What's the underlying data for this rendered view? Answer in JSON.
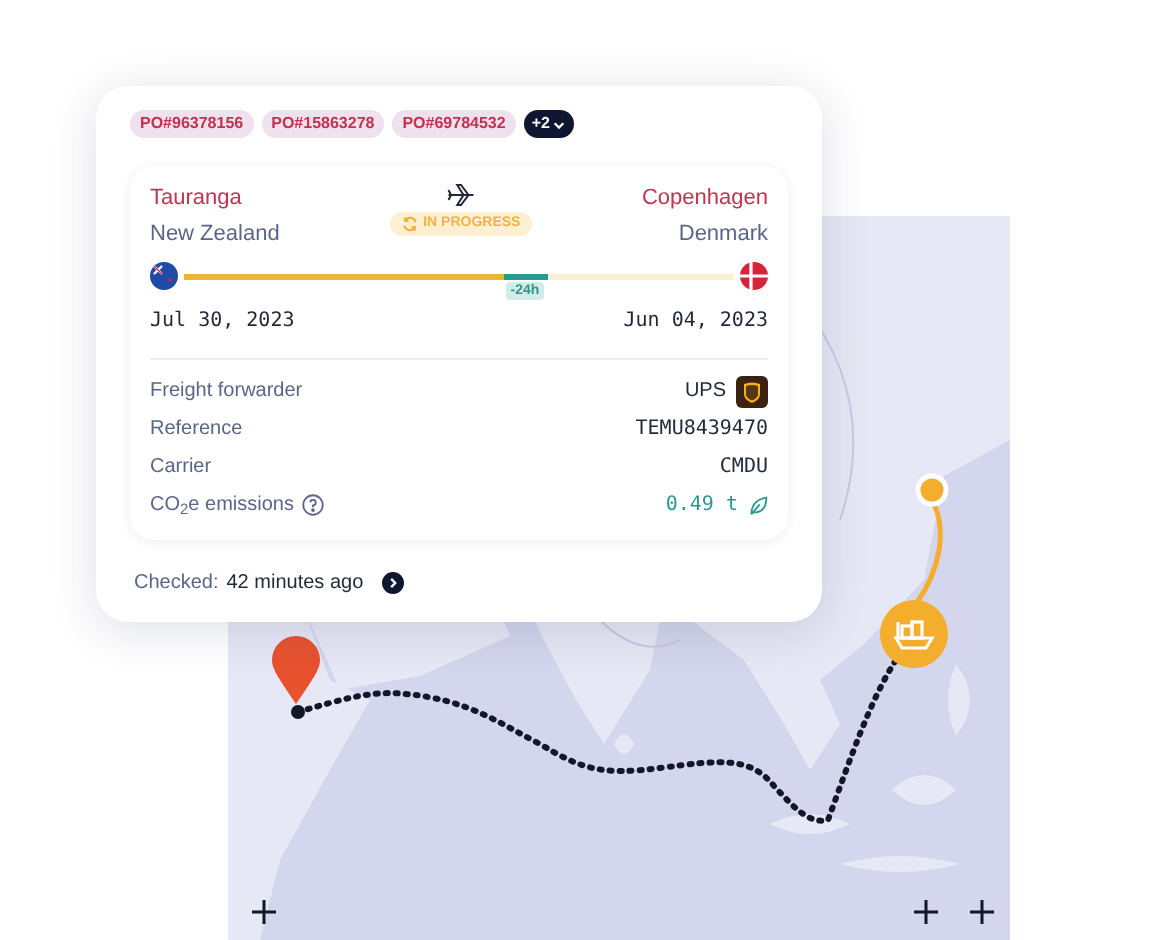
{
  "po_tags": [
    "PO#96378156",
    "PO#15863278",
    "PO#69784532"
  ],
  "more_tags": "+2",
  "origin": {
    "city": "Tauranga",
    "country": "New Zealand",
    "date": "Jul 30, 2023"
  },
  "destination": {
    "city": "Copenhagen",
    "country": "Denmark",
    "date": "Jun 04, 2023"
  },
  "status": "IN PROGRESS",
  "progress": {
    "level": 0.58,
    "delay": "-24h"
  },
  "details": [
    {
      "label": "Freight forwarder",
      "value": "UPS",
      "kind": "logo"
    },
    {
      "label": "Reference",
      "value": "TEMU8439470",
      "kind": "plain"
    },
    {
      "label": "Carrier",
      "value": "CMDU",
      "kind": "plain"
    },
    {
      "label": "CO$_{2}$e emissions",
      "value": "0.49 t",
      "kind": "emissions"
    }
  ],
  "checked": {
    "label": "Checked:",
    "value": "42 minutes ago"
  }
}
